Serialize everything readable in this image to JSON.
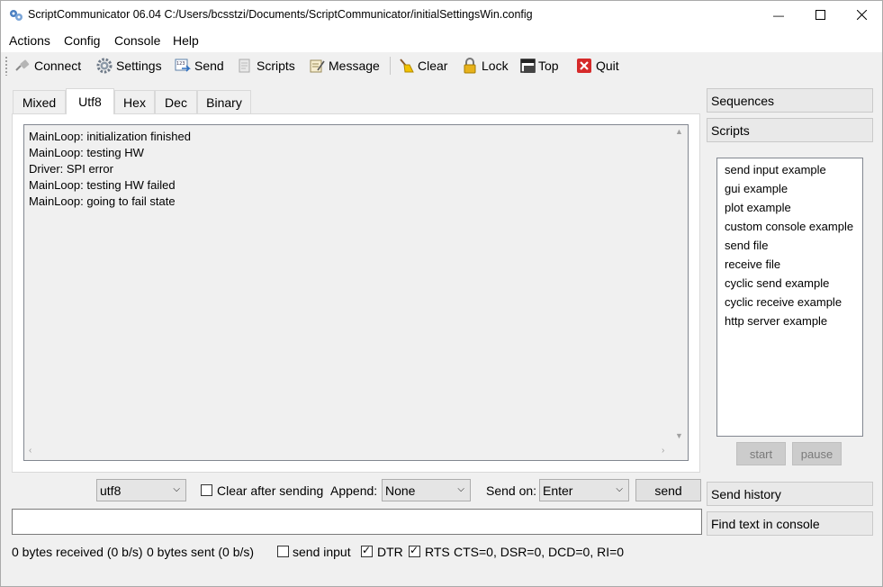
{
  "window": {
    "title": "ScriptCommunicator 06.04   C:/Users/bcsstzi/Documents/ScriptCommunicator/initialSettingsWin.config",
    "min_glyph": "—",
    "max_glyph": "☐",
    "close_glyph": "✕"
  },
  "menu": [
    "Actions",
    "Config",
    "Console",
    "Help"
  ],
  "toolbar": {
    "connect": "Connect",
    "settings": "Settings",
    "send": "Send",
    "scripts": "Scripts",
    "message": "Message",
    "clear": "Clear",
    "lock": "Lock",
    "top": "Top",
    "quit": "Quit"
  },
  "tabs": [
    "Mixed",
    "Utf8",
    "Hex",
    "Dec",
    "Binary"
  ],
  "active_tab": "Utf8",
  "console_lines": [
    "MainLoop: initialization finished",
    "MainLoop: testing HW",
    "Driver: SPI error",
    "MainLoop: testing HW failed",
    "MainLoop: going to fail state"
  ],
  "side": {
    "sequences": "Sequences",
    "scripts": "Scripts",
    "script_list": [
      "send input example",
      "gui example",
      "plot example",
      "custom console example",
      "send file",
      "receive file",
      "cyclic send example",
      "cyclic receive example",
      "http server example"
    ],
    "start": "start",
    "pause": "pause",
    "send_history": "Send history",
    "find_text": "Find text in console"
  },
  "send_row": {
    "format": "utf8",
    "clear_after_sending": "Clear after sending",
    "append_label": "Append:",
    "append_value": "None",
    "send_on_label": "Send on:",
    "send_on_value": "Enter",
    "send_button": "send",
    "input_value": ""
  },
  "status": {
    "received": "0 bytes received (0 b/s)",
    "sent": "0 bytes sent (0 b/s)",
    "send_input": "send input",
    "send_input_checked": false,
    "dtr": "DTR",
    "dtr_checked": true,
    "rts": "RTS",
    "rts_checked": true,
    "signals": "CTS=0, DSR=0, DCD=0, RI=0"
  },
  "icons": {
    "app": "app-gears-icon",
    "connect": "connect-plug-icon",
    "settings": "gear-icon",
    "send": "send-icon",
    "scripts": "scripts-icon",
    "message": "message-icon",
    "clear": "broom-icon",
    "lock": "lock-icon",
    "top": "window-top-icon",
    "quit": "quit-x-icon"
  }
}
